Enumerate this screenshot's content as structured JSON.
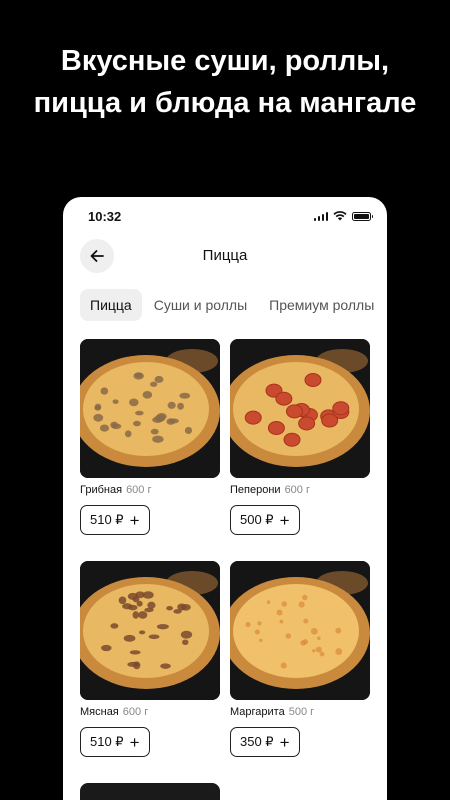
{
  "promo": {
    "title": "Вкусные суши, роллы, пицца и блюда на мангале"
  },
  "status_bar": {
    "time": "10:32"
  },
  "header": {
    "title": "Пицца"
  },
  "tabs": [
    {
      "label": "Пицца",
      "active": true
    },
    {
      "label": "Суши и роллы",
      "active": false
    },
    {
      "label": "Премиум роллы",
      "active": false
    }
  ],
  "products": [
    {
      "name": "Грибная",
      "weight": "600 г",
      "price": "510 ₽",
      "topping": "mushroom"
    },
    {
      "name": "Пеперони",
      "weight": "600 г",
      "price": "500 ₽",
      "topping": "pepperoni"
    },
    {
      "name": "Мясная",
      "weight": "600 г",
      "price": "510 ₽",
      "topping": "meat"
    },
    {
      "name": "Маргарита",
      "weight": "500 г",
      "price": "350 ₽",
      "topping": "margherita"
    }
  ],
  "colors": {
    "background": "#000000",
    "card_bg": "#ffffff",
    "tab_active_bg": "#efefef",
    "pepperoni": "#c94a2e",
    "cheese": "#e8b866"
  }
}
